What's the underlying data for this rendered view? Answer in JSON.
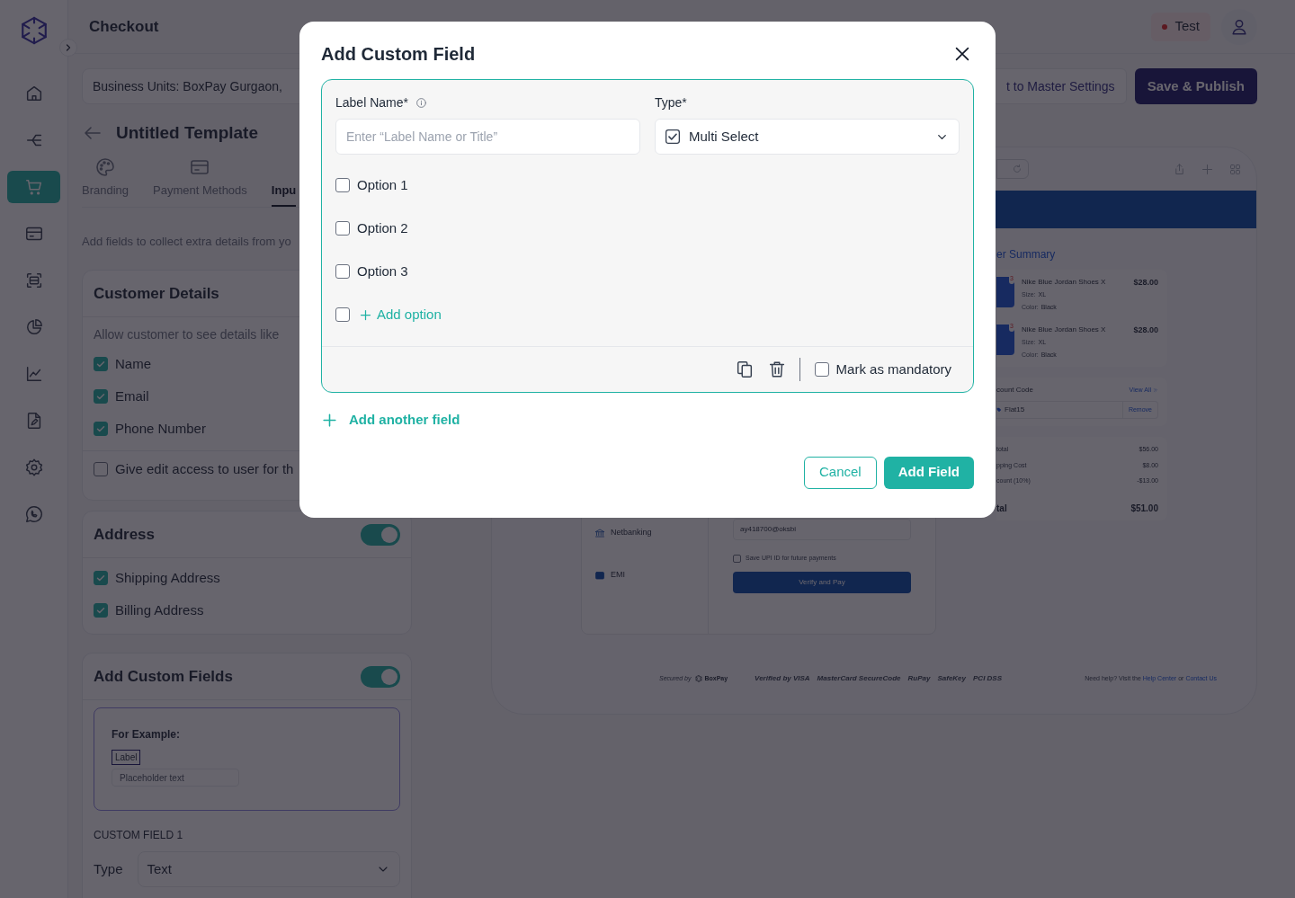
{
  "sidebar": {
    "items": [
      {
        "kind": "home",
        "selected": false
      },
      {
        "kind": "flows",
        "selected": false
      },
      {
        "kind": "cart",
        "selected": true
      },
      {
        "kind": "card",
        "selected": false
      },
      {
        "kind": "scan",
        "selected": false
      },
      {
        "kind": "pie",
        "selected": false
      },
      {
        "kind": "chart",
        "selected": false
      },
      {
        "kind": "document",
        "selected": false
      },
      {
        "kind": "settings",
        "selected": false
      },
      {
        "kind": "chat",
        "selected": false
      }
    ]
  },
  "header": {
    "title": "Checkout",
    "environment": "Test"
  },
  "toolbar": {
    "business_units": "Business Units: BoxPay Gurgaon,",
    "actions": [
      {
        "label": "t to Master Settings",
        "kind": "secondary"
      },
      {
        "label": "Save & Publish",
        "kind": "primary"
      }
    ]
  },
  "template": {
    "title": "Untitled Template",
    "tabs": [
      {
        "label": "Branding",
        "kind": "palette",
        "selected": false
      },
      {
        "label": "Payment Methods",
        "kind": "card",
        "selected": false
      },
      {
        "label": "Inpu",
        "kind": "none",
        "selected": true
      }
    ],
    "description": "Add fields to collect extra details from yo"
  },
  "customer_details": {
    "title": "Customer Details",
    "note": "Allow customer to see details like",
    "items": [
      {
        "label": "Name",
        "checked": true
      },
      {
        "label": "Email",
        "checked": true
      },
      {
        "label": "Phone Number",
        "checked": true
      }
    ],
    "edit_access": {
      "label": "Give edit access to user for th",
      "checked": false
    }
  },
  "address": {
    "title": "Address",
    "on": true,
    "items": [
      {
        "label": "Shipping Address",
        "checked": true
      },
      {
        "label": "Billing Address",
        "checked": true
      }
    ]
  },
  "custom_fields": {
    "title": "Add Custom Fields",
    "on": true,
    "example": {
      "heading": "For Example:",
      "label": "Label",
      "placeholder": "Placeholder text"
    },
    "field_heading": "CUSTOM FIELD 1",
    "type_label": "Type",
    "type_value": "Text"
  },
  "preview": {
    "payment_methods": [
      {
        "label": "Netbanking",
        "kind": "bank"
      },
      {
        "label": "EMI",
        "kind": "wallet"
      }
    ],
    "upi_value": "ay418700@oksbi",
    "save_upi": {
      "label": "Save UPI ID for future payments",
      "checked": false
    },
    "pay_button": "Verify and Pay",
    "summary": {
      "title": "er Summary",
      "items": [
        {
          "quantity": "3",
          "name": "Nike Blue Jordan Shoes X",
          "size_label": "Size:",
          "size": "XL",
          "color_label": "Color:",
          "color_value": "Black",
          "price": "$28.00"
        },
        {
          "quantity": "3",
          "name": "Nike Blue Jordan Shoes X",
          "size_label": "Size:",
          "size": "XL",
          "color_label": "Color:",
          "color_value": "Black",
          "price": "$28.00"
        }
      ],
      "discount": {
        "title": "count Code",
        "view_all": "View All",
        "code": "Flat15",
        "remove": "Remove"
      },
      "totals": [
        {
          "label": "total",
          "value": "$56.00",
          "kind": "line"
        },
        {
          "label": "pping Cost",
          "value": "$8.00",
          "kind": "line"
        },
        {
          "label": "count (10%)",
          "value": "-$13.00",
          "kind": "line"
        },
        {
          "label": "tal",
          "value": "$51.00",
          "kind": "grand"
        }
      ]
    },
    "footer": {
      "secured_by": "Secured by",
      "brand": "BoxPay",
      "badges": [
        "Verified by VISA",
        "MasterCard SecureCode",
        "RuPay",
        "SafeKey",
        "PCI DSS"
      ],
      "help_text": "Need help? Visit the",
      "help_link": "Help Center",
      "help_or": "or",
      "contact_link": "Contact Us"
    }
  },
  "modal": {
    "title": "Add Custom Field",
    "label_name": {
      "label": "Label Name*",
      "placeholder": "Enter “Label Name or Title”"
    },
    "type": {
      "label": "Type*",
      "value": "Multi Select"
    },
    "options": [
      {
        "label": "Option 1",
        "checked": false
      },
      {
        "label": "Option 2",
        "checked": false
      },
      {
        "label": "Option 3",
        "checked": false
      }
    ],
    "add_option": {
      "label": "Add option",
      "checked": false
    },
    "mandatory": {
      "label": "Mark as mandatory",
      "checked": false
    },
    "add_another": "Add another field",
    "buttons": [
      {
        "label": "Cancel",
        "kind": "secondary"
      },
      {
        "label": "Add Field",
        "kind": "primary"
      }
    ]
  }
}
